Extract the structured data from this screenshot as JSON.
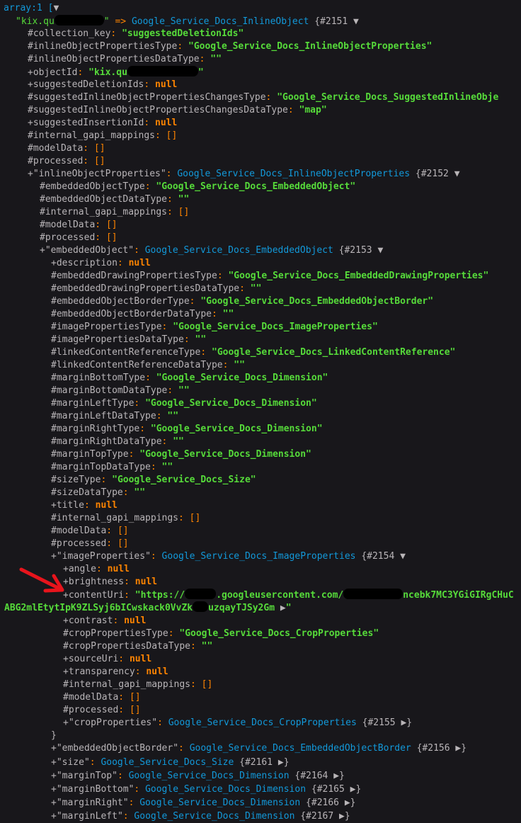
{
  "dump": {
    "root_label": "array:1",
    "root_key": "kix.qu",
    "root_class": "Google_Service_Docs_InlineObject",
    "root_ref": "{#2151",
    "collection_key": "suggestedDeletionIds",
    "inline_props_type": "Google_Service_Docs_InlineObjectProperties",
    "object_id": "kix.qu",
    "suggested_props_changes_type": "Google_Service_Docs_SuggestedInlineObje",
    "map": "map",
    "iop_class": "Google_Service_Docs_InlineObjectProperties",
    "iop_ref": "{#2152",
    "embedded_object_type": "Google_Service_Docs_EmbeddedObject",
    "eo_class": "Google_Service_Docs_EmbeddedObject",
    "eo_ref": "{#2153",
    "drawing_props_type": "Google_Service_Docs_EmbeddedDrawingProperties",
    "border_type": "Google_Service_Docs_EmbeddedObjectBorder",
    "image_props_type": "Google_Service_Docs_ImageProperties",
    "linked_ref_type": "Google_Service_Docs_LinkedContentReference",
    "dimension_type": "Google_Service_Docs_Dimension",
    "size_type": "Google_Service_Docs_Size",
    "ip_class": "Google_Service_Docs_ImageProperties",
    "ip_ref": "{#2154",
    "content_uri_start": "\"https://",
    "content_uri_mid": ".googleusercontent.com/",
    "content_uri_end": "ncebk7MC3YGiGIRgCHuC",
    "content_uri_line2_a": "ABG2mlEtytIpK9ZLSyj6bICwskack0VvZk",
    "content_uri_line2_b": "uzqayTJSy2Gm",
    "crop_props_type": "Google_Service_Docs_CropProperties",
    "crop_class": "Google_Service_Docs_CropProperties",
    "crop_ref": "{#2155",
    "border_class": "Google_Service_Docs_EmbeddedObjectBorder",
    "border_ref": "{#2156",
    "size_class": "Google_Service_Docs_Size",
    "size_ref": "{#2161",
    "dim_class": "Google_Service_Docs_Dimension",
    "margin_top_ref": "{#2164",
    "margin_bottom_ref": "{#2165",
    "margin_right_ref": "{#2166",
    "margin_left_ref": "{#2167",
    "k": {
      "collection_key": "#collection_key",
      "inlineObjectPropertiesType": "#inlineObjectPropertiesType",
      "inlineObjectPropertiesDataType": "#inlineObjectPropertiesDataType",
      "objectId": "+objectId",
      "suggestedDeletionIds": "+suggestedDeletionIds",
      "suggestedInlineObjectPropertiesChangesType": "#suggestedInlineObjectPropertiesChangesType",
      "suggestedInlineObjectPropertiesChangesDataType": "#suggestedInlineObjectPropertiesChangesDataType",
      "suggestedInsertionId": "+suggestedInsertionId",
      "internal_gapi_mappings": "#internal_gapi_mappings",
      "modelData": "#modelData",
      "processed": "#processed",
      "inlineObjectProperties": "inlineObjectProperties",
      "embeddedObjectType": "#embeddedObjectType",
      "embeddedObjectDataType": "#embeddedObjectDataType",
      "embeddedObject": "embeddedObject",
      "description": "+description",
      "embeddedDrawingPropertiesType": "#embeddedDrawingPropertiesType",
      "embeddedDrawingPropertiesDataType": "#embeddedDrawingPropertiesDataType",
      "embeddedObjectBorderType": "#embeddedObjectBorderType",
      "embeddedObjectBorderDataType": "#embeddedObjectBorderDataType",
      "imagePropertiesType": "#imagePropertiesType",
      "imagePropertiesDataType": "#imagePropertiesDataType",
      "linkedContentReferenceType": "#linkedContentReferenceType",
      "linkedContentReferenceDataType": "#linkedContentReferenceDataType",
      "marginBottomType": "#marginBottomType",
      "marginBottomDataType": "#marginBottomDataType",
      "marginLeftType": "#marginLeftType",
      "marginLeftDataType": "#marginLeftDataType",
      "marginRightType": "#marginRightType",
      "marginRightDataType": "#marginRightDataType",
      "marginTopType": "#marginTopType",
      "marginTopDataType": "#marginTopDataType",
      "sizeType": "#sizeType",
      "sizeDataType": "#sizeDataType",
      "title": "+title",
      "imageProperties": "imageProperties",
      "angle": "+angle",
      "brightness": "+brightness",
      "contentUri": "+contentUri",
      "contrast": "+contrast",
      "cropPropertiesType": "#cropPropertiesType",
      "cropPropertiesDataType": "#cropPropertiesDataType",
      "sourceUri": "+sourceUri",
      "transparency": "+transparency",
      "cropProperties": "cropProperties",
      "embeddedObjectBorder": "embeddedObjectBorder",
      "size": "size",
      "marginTop": "marginTop",
      "marginBottom": "marginBottom",
      "marginRight": "marginRight",
      "marginLeft": "marginLeft"
    },
    "null": "null",
    "empty_array": "[]",
    "empty_string": "\"\"",
    "arrow_text": "=>",
    "brace_close": "}",
    "open_bracket": "["
  }
}
